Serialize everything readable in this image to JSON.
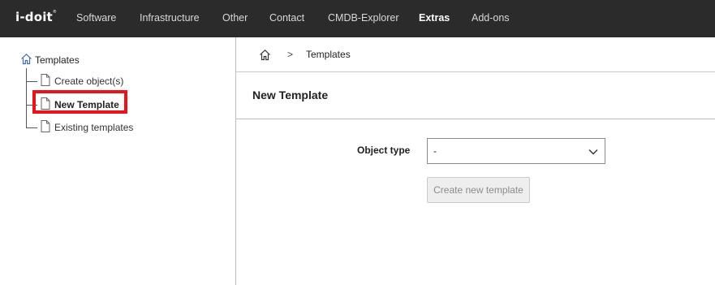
{
  "header": {
    "logo_text": "i-doit",
    "logo_mark": "®",
    "nav": [
      {
        "label": "Software",
        "active": false
      },
      {
        "label": "Infrastructure",
        "active": false
      },
      {
        "label": "Other",
        "active": false
      },
      {
        "label": "Contact",
        "active": false
      },
      {
        "label": "CMDB-Explorer",
        "active": false
      },
      {
        "label": "Extras",
        "active": true
      },
      {
        "label": "Add-ons",
        "active": false
      }
    ]
  },
  "sidebar": {
    "root": {
      "label": "Templates",
      "icon": "home-icon"
    },
    "items": [
      {
        "label": "Create object(s)",
        "icon": "document-icon",
        "selected": false
      },
      {
        "label": "New Template",
        "icon": "document-icon",
        "selected": true
      },
      {
        "label": "Existing templates",
        "icon": "document-icon",
        "selected": false
      }
    ],
    "highlight_color": "#e8141a"
  },
  "breadcrumb": {
    "home_icon": "home-icon",
    "separator": ">",
    "current": "Templates"
  },
  "main": {
    "title": "New Template",
    "form": {
      "object_type_label": "Object type",
      "object_type_value": "-",
      "create_button_label": "Create new template"
    }
  }
}
